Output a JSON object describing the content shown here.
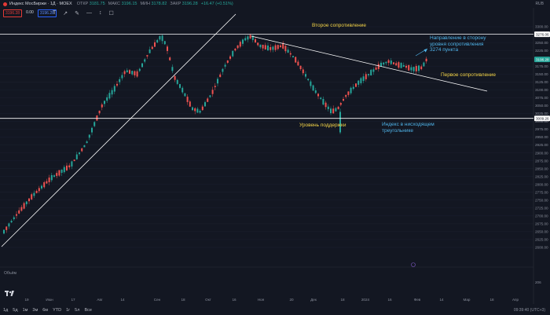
{
  "header": {
    "symbol": "Индекс МосБиржи · 1Д · MOEX",
    "ohlc": [
      {
        "k": "ОТКР",
        "v": "3181.75"
      },
      {
        "k": "МАКС",
        "v": "3196.15"
      },
      {
        "k": "МИН",
        "v": "3178.82"
      },
      {
        "k": "ЗАКР",
        "v": "3196.28"
      },
      {
        "k": "",
        "v": "+16.47 (+0.51%)"
      }
    ],
    "currency": "RUB",
    "price_boxes": [
      "3196.28",
      "0.00",
      "3196.28"
    ]
  },
  "drawing_tools": [
    "T",
    "↗",
    "✎",
    "—",
    "↕",
    "☐"
  ],
  "colors": {
    "up": "#26a69a",
    "down": "#ef5350",
    "annotation_yellow": "#f5d547",
    "annotation_blue": "#4fb3e8",
    "background": "#131722"
  },
  "price_axis": {
    "ticks": [
      "3300.00",
      "3275.00",
      "3250.00",
      "3225.00",
      "3200.00",
      "3175.00",
      "3150.00",
      "3125.00",
      "3100.00",
      "3075.00",
      "3050.00",
      "3025.00",
      "3000.00",
      "2975.00",
      "2950.00",
      "2925.00",
      "2900.00",
      "2875.00",
      "2850.00",
      "2825.00",
      "2800.00",
      "2775.00",
      "2750.00",
      "2725.00",
      "2700.00",
      "2675.00",
      "2650.00",
      "2625.00",
      "2600.00"
    ],
    "labels": {
      "resistance": "3276.06",
      "current": "3196.28",
      "support": "3009.26"
    }
  },
  "time_axis": [
    "19",
    "Июн",
    "17",
    "Авг",
    "14",
    "Сен",
    "18",
    "Окт",
    "16",
    "Ноя",
    "20",
    "Дек",
    "18",
    "2024",
    "16",
    "Фев",
    "14",
    "Мар",
    "18",
    "Апр"
  ],
  "annotations": {
    "second_resistance": "Второе сопротивление",
    "first_resistance": "Первое сопротивление",
    "support": "Уровень поддержки",
    "direction": [
      "Направление в сторону",
      "уровня сопротивления",
      "3274 пункта"
    ],
    "triangle": [
      "Индекс в нисходящем",
      "треугольнике"
    ]
  },
  "volume_label": "Объём",
  "timeframes": [
    "1д",
    "5д",
    "1м",
    "3м",
    "6м",
    "YTD",
    "1г",
    "5л",
    "Все"
  ],
  "clock": "09:39:40 (UTC+3)"
}
